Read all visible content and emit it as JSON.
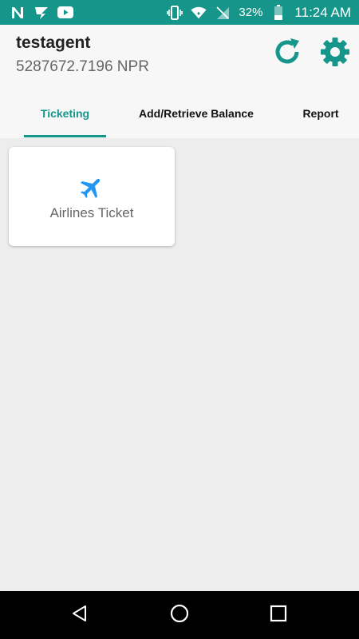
{
  "status_bar": {
    "left_icons": [
      "n-logo-icon",
      "s-logo-icon",
      "youtube-icon"
    ],
    "right_icons": [
      "vibrate-icon",
      "wifi-icon",
      "no-sim-icon",
      "battery-icon"
    ],
    "battery_percent": "32%",
    "time": "11:24 AM",
    "color": "#16968a"
  },
  "header": {
    "username": "testagent",
    "balance": "5287672.7196 NPR",
    "actions": [
      "refresh-icon",
      "settings-gear-icon"
    ],
    "accent_color": "#16968a"
  },
  "tabs": [
    {
      "label": "Ticketing",
      "active": true
    },
    {
      "label": "Add/Retrieve Balance",
      "active": false
    },
    {
      "label": "Report",
      "active": false
    }
  ],
  "services": [
    {
      "label": "Airlines Ticket",
      "icon": "airplane-icon",
      "icon_color": "#2196f3"
    }
  ],
  "nav_bar": {
    "buttons": [
      "back-icon",
      "home-icon",
      "recent-apps-icon"
    ]
  }
}
